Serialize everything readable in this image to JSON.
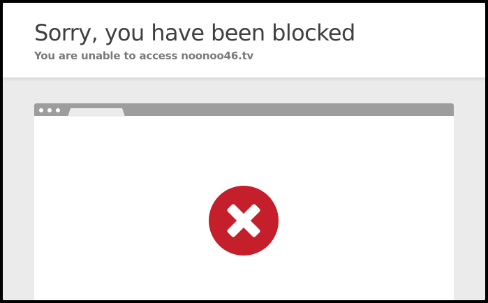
{
  "header": {
    "title": "Sorry, you have been blocked",
    "subtitle": "You are unable to access noonoo46.tv"
  },
  "illustration": {
    "icon": "blocked-x-icon",
    "icon_color": "#c41f2b",
    "bar_color": "#9d9d9d"
  },
  "colors": {
    "background": "#ebebeb",
    "header_background": "#ffffff",
    "title_text": "#404040",
    "subtitle_text": "#7a7a7a"
  }
}
